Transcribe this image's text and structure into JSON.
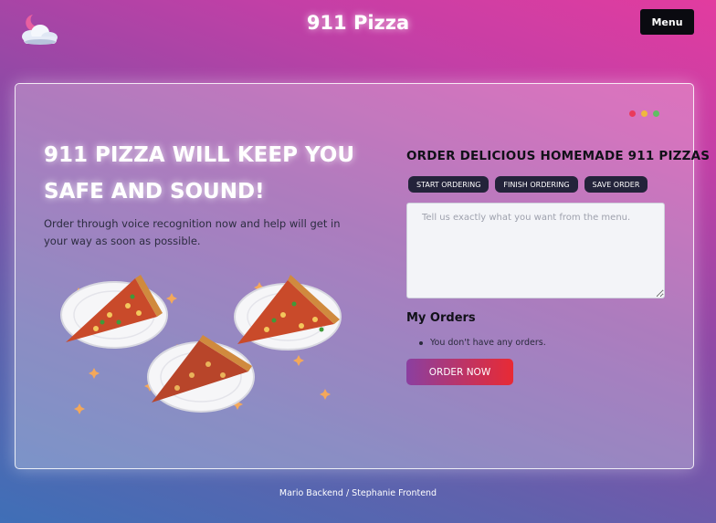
{
  "header": {
    "site_title": "911 Pizza",
    "menu_label": "Menu",
    "logo_icon": "cloud-moon-icon"
  },
  "window_dots": [
    {
      "name": "red-dot",
      "color": "#ea3a5a"
    },
    {
      "name": "yellow-dot",
      "color": "#f0b83f"
    },
    {
      "name": "green-dot",
      "color": "#5fbf62"
    }
  ],
  "hero": {
    "title_line1": "911 PIZZA WILL KEEP YOU",
    "title_line2": "SAFE AND SOUND!",
    "text": "Order through voice recognition now and help will get in your way as soon as possible.",
    "illustration_icon": "pizza-slices-illustration"
  },
  "order": {
    "heading": "ORDER DELICIOUS HOMEMADE 911 PIZZAS",
    "buttons": {
      "start": "START ORDERING",
      "finish": "FINISH ORDERING",
      "save": "SAVE ORDER"
    },
    "textarea_placeholder": "Tell us exactly what you want from the menu.",
    "textarea_value": ""
  },
  "my_orders": {
    "heading": "My Orders",
    "empty_text": "You don't have any orders.",
    "order_now_label": "ORDER NOW"
  },
  "footer": {
    "credits": "Mario Backend / Stephanie Frontend"
  },
  "colors": {
    "order_now_gradient_start": "#8b3fa0",
    "order_now_gradient_end": "#e82a34",
    "pill_bg": "#23233a"
  }
}
